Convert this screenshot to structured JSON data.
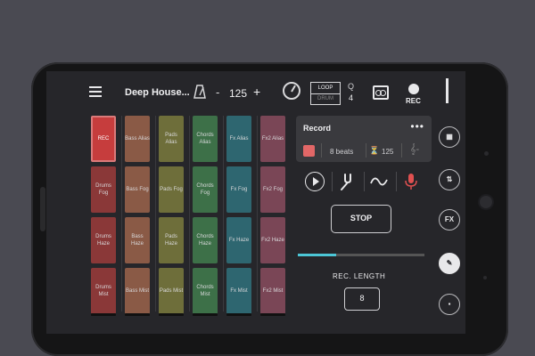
{
  "topbar": {
    "title": "Deep House...",
    "minus": "-",
    "tempo": "125",
    "plus": "+",
    "loop_label": "LOOP",
    "drum_label": "DRUM",
    "q_label": "Q",
    "q_value": "4",
    "rec_label": "REC"
  },
  "pads": {
    "columns": [
      {
        "name": "Drums",
        "color": "#8a3838",
        "rows": [
          "REC",
          "Drums Fog",
          "Drums Haze",
          "Drums Mist"
        ]
      },
      {
        "name": "Bass",
        "color": "#8a5a46",
        "rows": [
          "Bass Alias",
          "Bass Fog",
          "Bass Haze",
          "Bass Mist"
        ]
      },
      {
        "name": "Pads",
        "color": "#6e6e3a",
        "rows": [
          "Pads Alias",
          "Pads Fog",
          "Pads Haze",
          "Pads Mist"
        ]
      },
      {
        "name": "Chords",
        "color": "#3d7048",
        "rows": [
          "Chords Alias",
          "Chords Fog",
          "Chords Haze",
          "Chords Mist"
        ]
      },
      {
        "name": "Fx",
        "color": "#2e6670",
        "rows": [
          "Fx Alias",
          "Fx Fog",
          "Fx Haze",
          "Fx Mist"
        ]
      },
      {
        "name": "Fx2",
        "color": "#7a4656",
        "rows": [
          "Fx2 Alias",
          "Fx2 Fog",
          "Fx2 Haze",
          "Fx2 Mist"
        ]
      }
    ]
  },
  "record_panel": {
    "title": "Record",
    "menu": "•••",
    "beats": "8 beats",
    "bpm": "125",
    "clef": "𝄞-"
  },
  "controls": {
    "stop_label": "STOP",
    "progress_fraction": 0.3,
    "rec_length_label": "REC. LENGTH",
    "rec_length_value": "8"
  },
  "side_icons": {
    "fx_label": "FX"
  },
  "colors": {
    "accent_cyan": "#4cc6d6",
    "rec_red": "#e26767",
    "background": "#26262a"
  }
}
